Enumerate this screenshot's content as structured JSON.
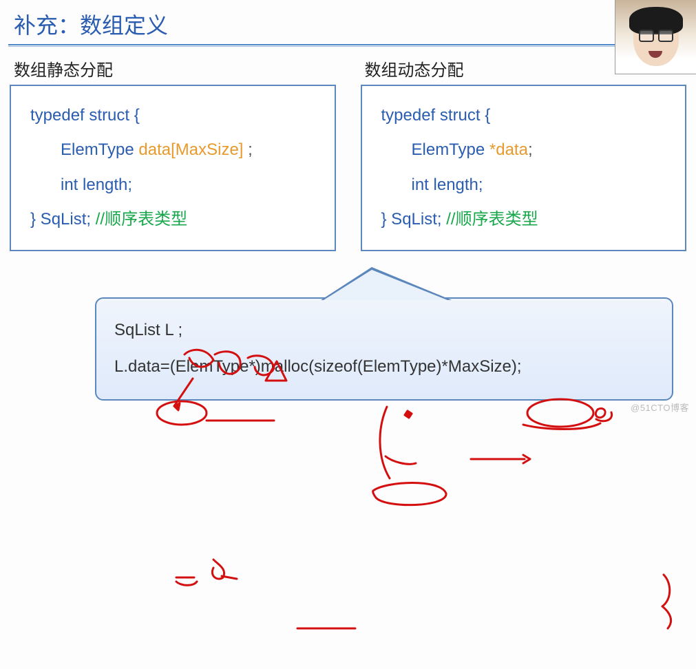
{
  "title": "补充：数组定义",
  "left": {
    "header": "数组静态分配",
    "line1": "typedef struct {",
    "line2_pre": "ElemType ",
    "line2_data": "data[MaxSize]",
    "line2_post": " ;",
    "line3": "int length;",
    "line4_pre": "} SqList;   ",
    "line4_cmt": "//顺序表类型"
  },
  "right": {
    "header": "数组动态分配",
    "line1": "typedef struct {",
    "line2_pre": "ElemType ",
    "line2_star": "*data",
    "line2_post": ";",
    "line3": "int length;",
    "line4_pre": "} SqList;   ",
    "line4_cmt": "//顺序表类型"
  },
  "bottom": {
    "l1": "SqList L ;",
    "l2": "L.data=(ElemType*)malloc(sizeof(ElemType)*MaxSize);"
  },
  "watermark": "@51CTO博客"
}
